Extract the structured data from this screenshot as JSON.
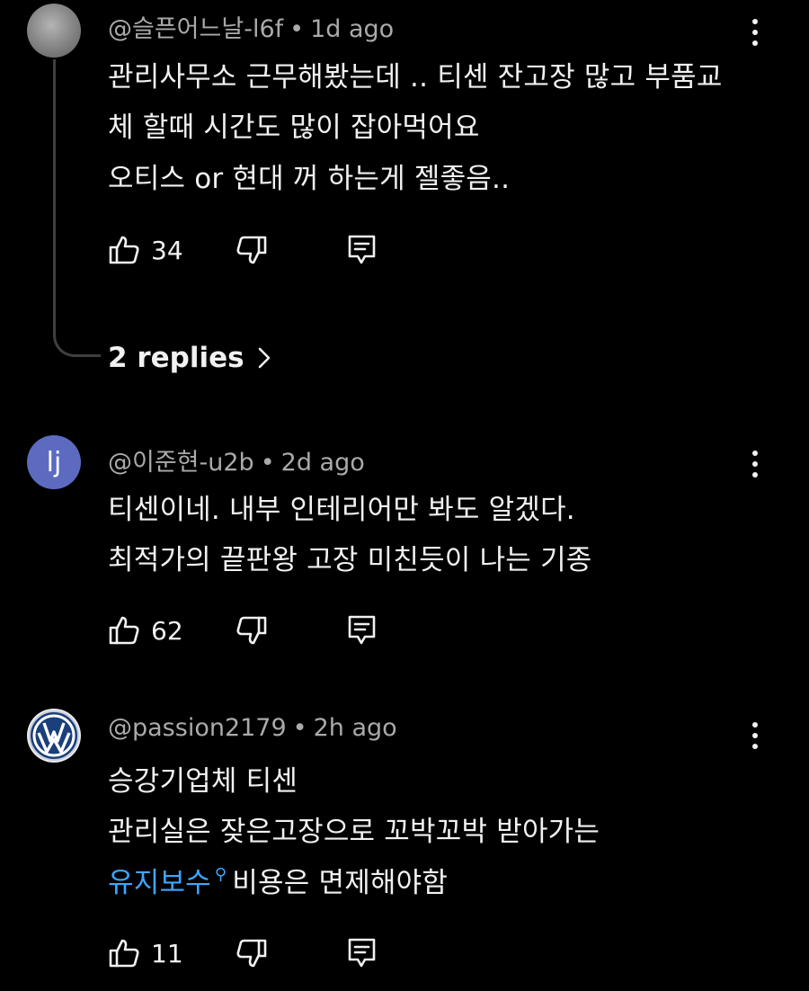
{
  "comments": [
    {
      "avatar_letter": "",
      "author": "@슬픈어느날-l6f",
      "time": "1d ago",
      "lines": [
        "관리사무소 근무해봤는데 .. 티센 잔고장 많고 부품교",
        "체 할때 시간도 많이 잡아먹어요",
        "오티스 or 현대 꺼 하는게 젤좋음.."
      ],
      "likes": "34",
      "replies_label": "2 replies"
    },
    {
      "avatar_letter": "lj",
      "author": "@이준현-u2b",
      "time": "2d ago",
      "lines": [
        "티센이네. 내부 인테리어만 봐도 알겠다.",
        "최적가의 끝판왕 고장 미친듯이 나는 기종"
      ],
      "likes": "62"
    },
    {
      "avatar_letter": "",
      "author": "@passion2179",
      "time": "2h ago",
      "lines": [
        "승강기업체 티센",
        "관리실은 잦은고장으로 꼬박꼬박 받아가는"
      ],
      "hashtag": "유지보수",
      "line3_rest": "비용은 면제해야함",
      "likes": "11"
    }
  ],
  "icons": {
    "like": "thumbs-up-icon",
    "dislike": "thumbs-down-icon",
    "reply": "reply-comment-icon",
    "more": "more-vert-icon",
    "chevron": "chevron-right-icon",
    "search": "search-icon"
  },
  "colors": {
    "background": "#000000",
    "text": "#f1f1f1",
    "meta": "#aaaaaa",
    "link": "#3ea6ff",
    "avatar_lj": "#5c6bc0"
  }
}
